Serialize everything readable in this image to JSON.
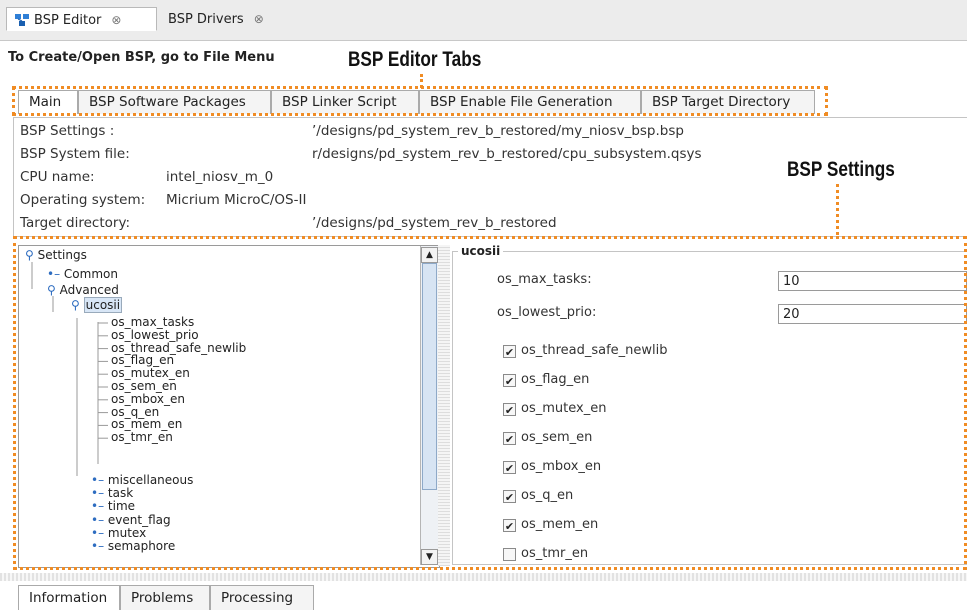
{
  "editor_tabs": [
    {
      "label": "BSP Editor",
      "icon": "bsp-editor-icon",
      "close": "⊗"
    },
    {
      "label": "BSP Drivers",
      "close": "⊗"
    }
  ],
  "header": "To Create/Open BSP, go to File Menu",
  "callouts": {
    "tabs": "BSP Editor Tabs",
    "settings": "BSP Settings"
  },
  "tabs": [
    "Main",
    "BSP Software Packages",
    "BSP Linker Script",
    "BSP Enable File Generation",
    "BSP Target Directory"
  ],
  "main": {
    "rows": [
      {
        "label": "BSP Settings :",
        "value": "",
        "path": "’/designs/pd_system_rev_b_restored/my_niosv_bsp.bsp"
      },
      {
        "label": "BSP System file:",
        "value": "",
        "path": "r/designs/pd_system_rev_b_restored/cpu_subsystem.qsys"
      },
      {
        "label": "CPU name:",
        "value": "intel_niosv_m_0",
        "path": ""
      },
      {
        "label": "Operating system:",
        "value": "Micrium MicroC/OS-II",
        "path": ""
      },
      {
        "label": "Target directory:",
        "value": "",
        "path": "’/designs/pd_system_rev_b_restored"
      }
    ]
  },
  "tree": {
    "root": "Settings",
    "common": "Common",
    "advanced": "Advanced",
    "ucosii": "ucosii",
    "ucosii_children": [
      "os_max_tasks",
      "os_lowest_prio",
      "os_thread_safe_newlib",
      "os_flag_en",
      "os_mutex_en",
      "os_sem_en",
      "os_mbox_en",
      "os_q_en",
      "os_mem_en",
      "os_tmr_en"
    ],
    "groups": [
      "miscellaneous",
      "task",
      "time",
      "event_flag",
      "mutex",
      "semaphore"
    ]
  },
  "panel": {
    "title": "ucosii",
    "fields": [
      {
        "label": "os_max_tasks:",
        "value": "10"
      },
      {
        "label": "os_lowest_prio:",
        "value": "20"
      }
    ],
    "checks": [
      {
        "label": "os_thread_safe_newlib",
        "checked": true
      },
      {
        "label": "os_flag_en",
        "checked": true
      },
      {
        "label": "os_mutex_en",
        "checked": true
      },
      {
        "label": "os_sem_en",
        "checked": true
      },
      {
        "label": "os_mbox_en",
        "checked": true
      },
      {
        "label": "os_q_en",
        "checked": true
      },
      {
        "label": "os_mem_en",
        "checked": true
      },
      {
        "label": "os_tmr_en",
        "checked": false
      }
    ],
    "check_mark": "✔"
  },
  "bottom_tabs": [
    "Information",
    "Problems",
    "Processing"
  ],
  "colors": {
    "callout_border": "#f08c24",
    "selection": "#d8e6f6"
  }
}
